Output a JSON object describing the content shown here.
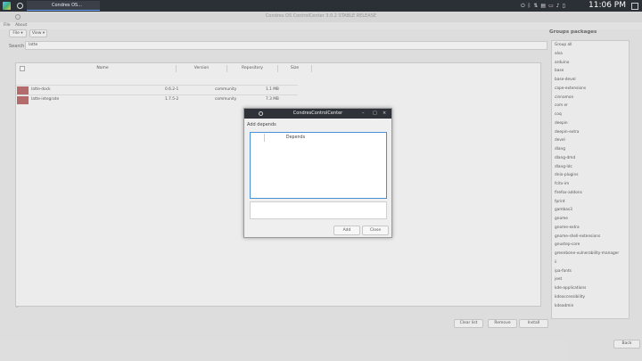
{
  "panel": {
    "task_label": "Condres OS...",
    "clock": "11:06 PM"
  },
  "window": {
    "title": "Condres OS ControlCenter 3.0.2 STABLE RELEASE",
    "menu": [
      "File",
      "About"
    ]
  },
  "toolbar": {
    "file_label": "File ▾",
    "view_label": "View ▾"
  },
  "search": {
    "label": "Search",
    "value": "latte"
  },
  "table": {
    "headers": [
      "Name",
      "Version",
      "Repository",
      "Size"
    ],
    "rows": [
      {
        "name": "latte-dock",
        "version": "0.6.2-1",
        "repository": "community",
        "size": "1.1 MB"
      },
      {
        "name": "latte-integrate",
        "version": "1.7.5-2",
        "repository": "community",
        "size": "7.3 MB"
      }
    ]
  },
  "groups": {
    "title": "Groups packages",
    "items": [
      "Group all",
      "alsa",
      "arduino",
      "base",
      "base-devel",
      "cape-extensions",
      "cinnamon",
      "com er",
      "coq",
      "deepin",
      "deepin-extra",
      "devel",
      "dlang",
      "dlang-dmd",
      "dlang-ldc",
      "dnio-plugins",
      "fcitx-im",
      "firefox-addons",
      "fprint",
      "gambas3",
      "gnome",
      "gnome-extra",
      "gnome-shell-extensions",
      "gnustep-core",
      "greenbone-vulnerability-manager",
      "ii",
      "ipa-fonts",
      "jeet",
      "kde-applications",
      "kdeaccessibility",
      "kdeadmin"
    ]
  },
  "actions": {
    "clear": "Clear list",
    "remove": "Remove",
    "install": "Install",
    "back": "Back"
  },
  "dialog": {
    "title": "CondresControlCenter",
    "heading": "Add depends",
    "column": "Depends",
    "add": "Add",
    "close": "Close"
  }
}
